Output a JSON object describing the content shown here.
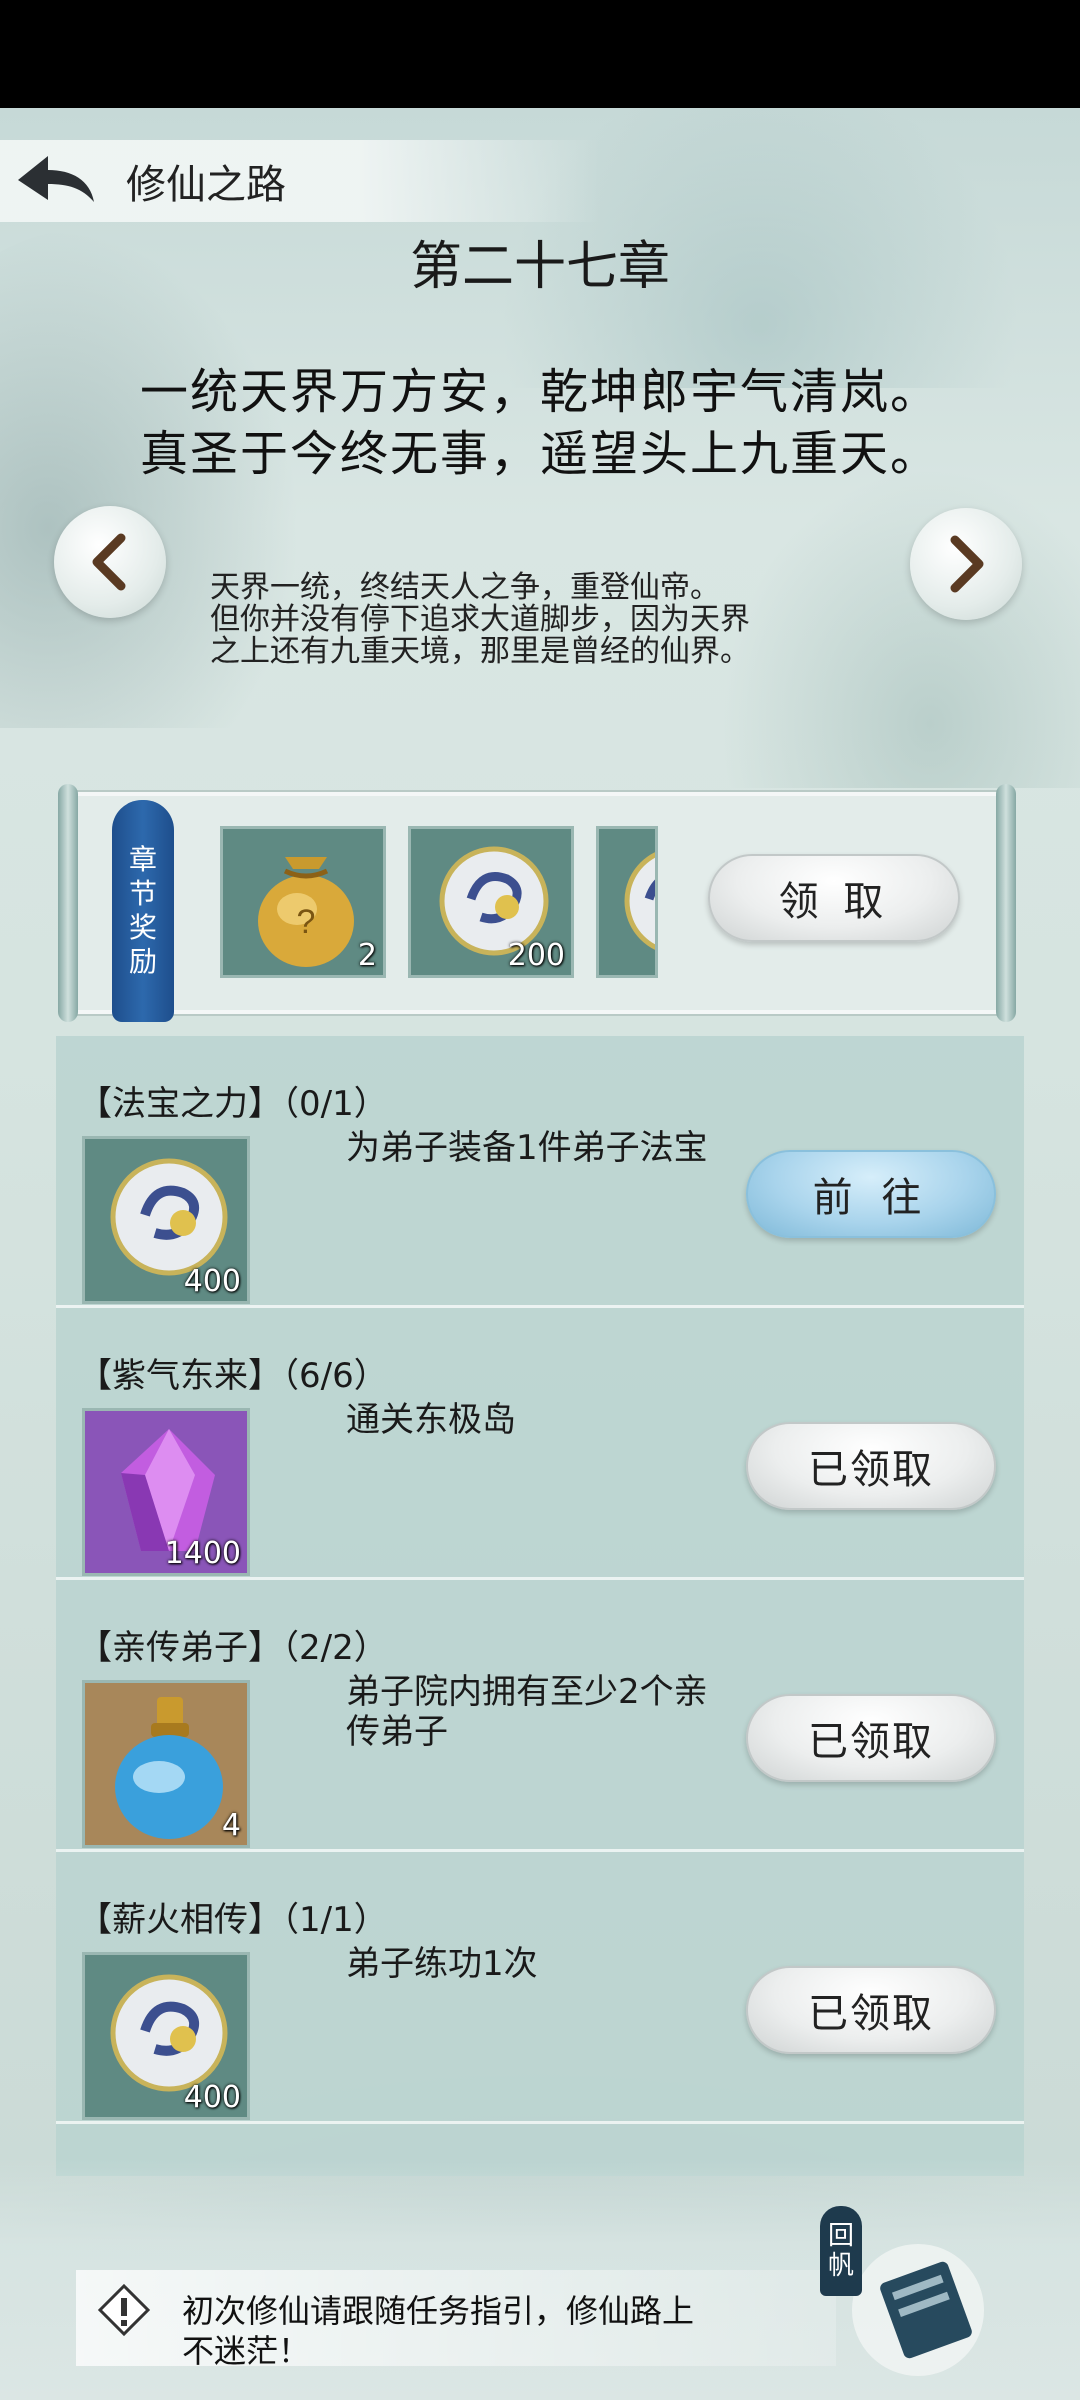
{
  "header": {
    "title": "修仙之路"
  },
  "chapter": {
    "title": "第二十七章",
    "poem": [
      "一统天界万方安，乾坤郎宇气清岚。",
      "真圣于今终无事，遥望头上九重天。"
    ],
    "description": [
      "天界一统，终结天人之争，重登仙帝。",
      "但你并没有停下追求大道脚步，因为天界",
      "之上还有九重天境，那里是曾经的仙界。"
    ]
  },
  "chapter_reward": {
    "label_chars": [
      "章",
      "节",
      "奖",
      "励"
    ],
    "items": [
      {
        "icon": "gold-pouch-icon",
        "count": "2"
      },
      {
        "icon": "spirit-orb-icon",
        "count": "200"
      },
      {
        "icon": "spirit-orb-icon",
        "count": ""
      }
    ],
    "claim_label": "领 取"
  },
  "tasks": [
    {
      "title": "【法宝之力】（0/1）",
      "desc": "为弟子装备1件弟子法宝",
      "item_icon": "spirit-orb-icon",
      "item_count": "400",
      "button": "前 往",
      "state": "go"
    },
    {
      "title": "【紫气东来】（6/6）",
      "desc": "通关东极岛",
      "item_icon": "purple-crystal-icon",
      "item_count": "1400",
      "button": "已领取",
      "state": "claimed"
    },
    {
      "title": "【亲传弟子】（2/2）",
      "desc": "弟子院内拥有至少2个亲传弟子",
      "item_icon": "blue-potion-icon",
      "item_count": "4",
      "button": "已领取",
      "state": "claimed"
    },
    {
      "title": "【薪火相传】（1/1）",
      "desc": "弟子练功1次",
      "item_icon": "spirit-orb-icon",
      "item_count": "400",
      "button": "已领取",
      "state": "claimed"
    }
  ],
  "footer": {
    "tip_lines": [
      "初次修仙请跟随任务指引，修仙路上",
      "不迷茫！"
    ],
    "return_label": [
      "回",
      "帆"
    ]
  },
  "colors": {
    "ribbon": "#2d69ad",
    "go_button": "#a9d4ec",
    "panel": "#e3ecea"
  }
}
